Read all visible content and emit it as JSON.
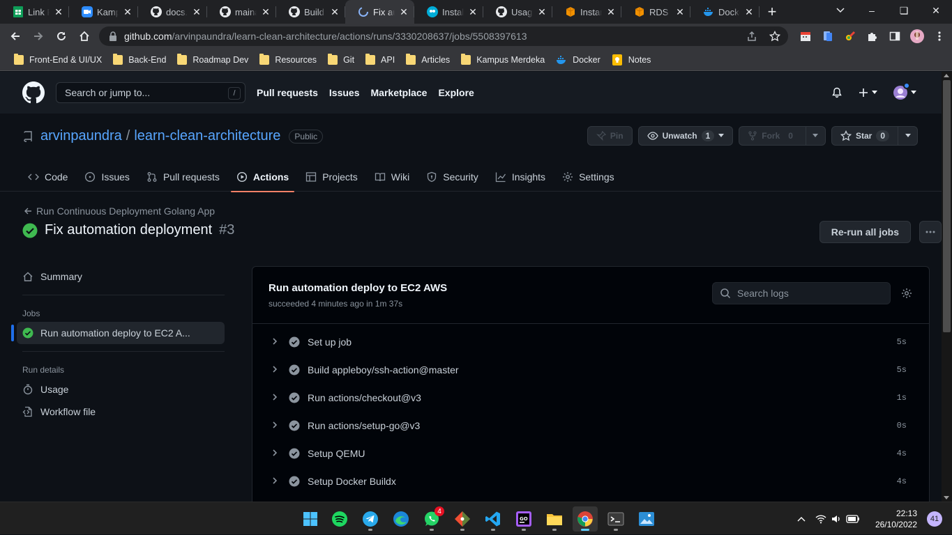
{
  "browser": {
    "tabs": [
      {
        "title": "Link Re",
        "icon": "google-sheets-icon"
      },
      {
        "title": "Kampu",
        "icon": "zoom-icon"
      },
      {
        "title": "docs.g",
        "icon": "github-icon"
      },
      {
        "title": "mainar",
        "icon": "github-icon"
      },
      {
        "title": "Build a",
        "icon": "github-icon"
      },
      {
        "title": "Fix aut",
        "icon": "github-actions-loading-icon"
      },
      {
        "title": "Install",
        "icon": "go-icon"
      },
      {
        "title": "Usage",
        "icon": "github-icon"
      },
      {
        "title": "Instanc",
        "icon": "aws-icon"
      },
      {
        "title": "RDS M",
        "icon": "aws-icon"
      },
      {
        "title": "Docke",
        "icon": "docker-icon"
      }
    ],
    "active_tab_index": 5,
    "url_host": "github.com",
    "url_path": "/arvinpaundra/learn-clean-architecture/actions/runs/3330208637/jobs/5508397613",
    "bookmarks": [
      {
        "label": "Front-End & UI/UX",
        "icon": "folder-icon"
      },
      {
        "label": "Back-End",
        "icon": "folder-icon"
      },
      {
        "label": "Roadmap Dev",
        "icon": "folder-icon"
      },
      {
        "label": "Resources",
        "icon": "folder-icon"
      },
      {
        "label": "Git",
        "icon": "folder-icon"
      },
      {
        "label": "API",
        "icon": "folder-icon"
      },
      {
        "label": "Articles",
        "icon": "folder-icon"
      },
      {
        "label": "Kampus Merdeka",
        "icon": "folder-icon"
      },
      {
        "label": "Docker",
        "icon": "docker-icon"
      },
      {
        "label": "Notes",
        "icon": "keep-notes-icon"
      }
    ]
  },
  "github": {
    "search_placeholder": "Search or jump to...",
    "search_key": "/",
    "nav": [
      "Pull requests",
      "Issues",
      "Marketplace",
      "Explore"
    ],
    "repo": {
      "owner": "arvinpaundra",
      "name": "learn-clean-architecture",
      "visibility": "Public",
      "pin_label": "Pin",
      "watch_label": "Unwatch",
      "watch_count": "1",
      "fork_label": "Fork",
      "fork_count": "0",
      "star_label": "Star",
      "star_count": "0"
    },
    "tabs": [
      {
        "label": "Code",
        "icon": "code-icon"
      },
      {
        "label": "Issues",
        "icon": "issue-icon"
      },
      {
        "label": "Pull requests",
        "icon": "pull-request-icon"
      },
      {
        "label": "Actions",
        "icon": "play-icon"
      },
      {
        "label": "Projects",
        "icon": "table-icon"
      },
      {
        "label": "Wiki",
        "icon": "book-icon"
      },
      {
        "label": "Security",
        "icon": "shield-icon"
      },
      {
        "label": "Insights",
        "icon": "graph-icon"
      },
      {
        "label": "Settings",
        "icon": "gear-icon"
      }
    ],
    "active_tab": "Actions",
    "run": {
      "workflow_name": "Run Continuous Deployment Golang App",
      "title": "Fix automation deployment",
      "number": "#3",
      "rerun_label": "Re-run all jobs"
    },
    "sidebar": {
      "summary": "Summary",
      "jobs_heading": "Jobs",
      "job": "Run automation deploy to EC2 A...",
      "run_details_heading": "Run details",
      "usage": "Usage",
      "workflow_file": "Workflow file"
    },
    "job": {
      "title": "Run automation deploy to EC2 AWS",
      "meta": "succeeded 4 minutes ago in 1m 37s",
      "search_placeholder": "Search logs",
      "steps": [
        {
          "name": "Set up job",
          "duration": "5s"
        },
        {
          "name": "Build appleboy/ssh-action@master",
          "duration": "5s"
        },
        {
          "name": "Run actions/checkout@v3",
          "duration": "1s"
        },
        {
          "name": "Run actions/setup-go@v3",
          "duration": "0s"
        },
        {
          "name": "Setup QEMU",
          "duration": "4s"
        },
        {
          "name": "Setup Docker Buildx",
          "duration": "4s"
        }
      ]
    }
  },
  "taskbar": {
    "apps": [
      "windows-start-icon",
      "spotify-icon",
      "telegram-icon",
      "edge-icon",
      "whatsapp-icon",
      "git-gui-icon",
      "vscode-icon",
      "goland-icon",
      "file-explorer-icon",
      "chrome-icon",
      "terminal-icon",
      "photos-icon"
    ],
    "whatsapp_badge": "4",
    "time": "22:13",
    "date": "26/10/2022",
    "notifications": "41"
  },
  "colors": {
    "accent_blue": "#58a6ff",
    "success": "#3fb950",
    "tab_underline": "#f78166",
    "selection_bar": "#1f6feb"
  }
}
